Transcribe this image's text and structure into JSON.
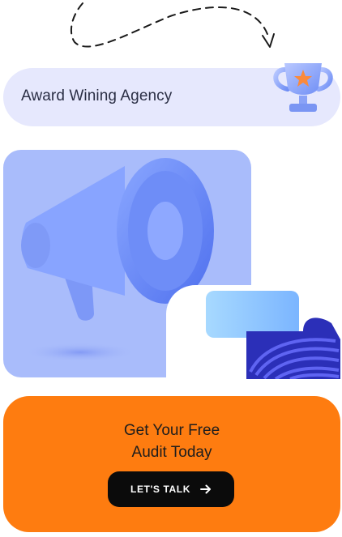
{
  "award": {
    "text": "Award Wining Agency",
    "icon": "trophy-icon"
  },
  "cta": {
    "line1": "Get Your Free",
    "line2": "Audit Today",
    "button_label": "LET'S TALK",
    "button_icon": "arrow-right-icon"
  },
  "illustrations": {
    "main": "megaphone-illustration",
    "secondary": "abstract-waves-illustration",
    "decoration": "dashed-arrow-icon"
  },
  "colors": {
    "award_bg": "#e6e8fd",
    "panel_bg": "#a9bcfb",
    "cta_bg": "#fe7c10",
    "button_bg": "#0b0b0b"
  }
}
